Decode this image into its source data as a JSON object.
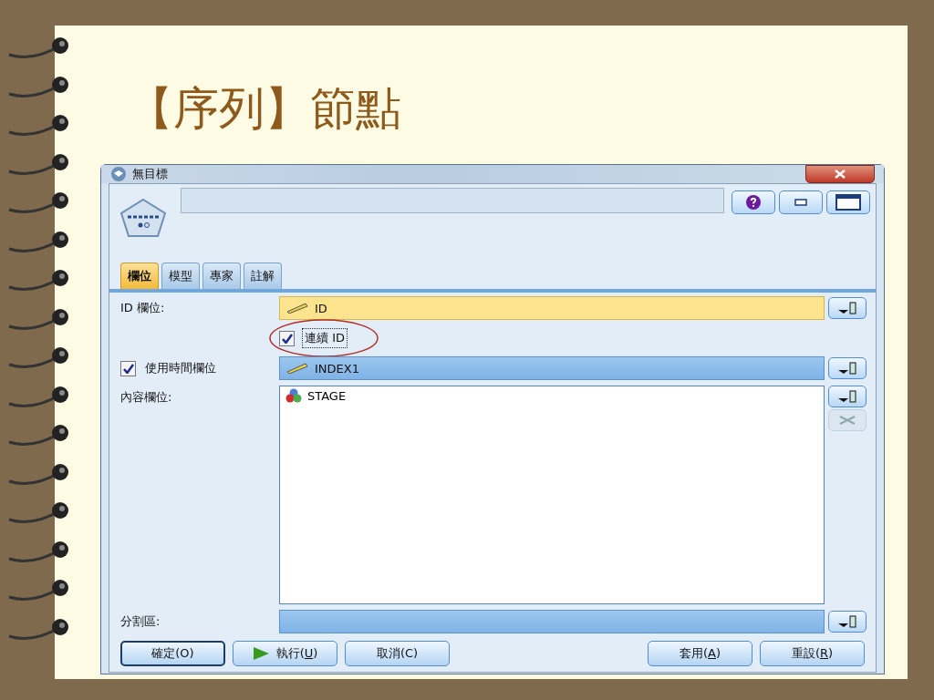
{
  "slide_title": "【序列】節點",
  "window": {
    "title": "無目標"
  },
  "tabs": [
    {
      "label": "欄位",
      "selected": true
    },
    {
      "label": "模型",
      "selected": false
    },
    {
      "label": "專家",
      "selected": false
    },
    {
      "label": "註解",
      "selected": false
    }
  ],
  "id_field": {
    "label": "ID 欄位:",
    "value": "ID",
    "required": true
  },
  "continuous_id": {
    "label": "連續 ID",
    "checked": true
  },
  "time_field": {
    "label": "使用時間欄位",
    "checked": true,
    "value": "INDEX1",
    "selected": true
  },
  "content_fields": {
    "label": "內容欄位:",
    "items": [
      "STAGE"
    ]
  },
  "partition": {
    "label": "分割區:"
  },
  "buttons_left": [
    {
      "kind": "plain",
      "text": "確定(O)"
    },
    {
      "kind": "run",
      "text": "執行(",
      "underlined": "U",
      "end": ")"
    },
    {
      "kind": "plain",
      "text": "取消(C)"
    }
  ],
  "buttons_right": [
    {
      "text": "套用(",
      "underlined": "A",
      "end": ")"
    },
    {
      "text": "重設(",
      "underlined": "R",
      "end": ")"
    }
  ]
}
